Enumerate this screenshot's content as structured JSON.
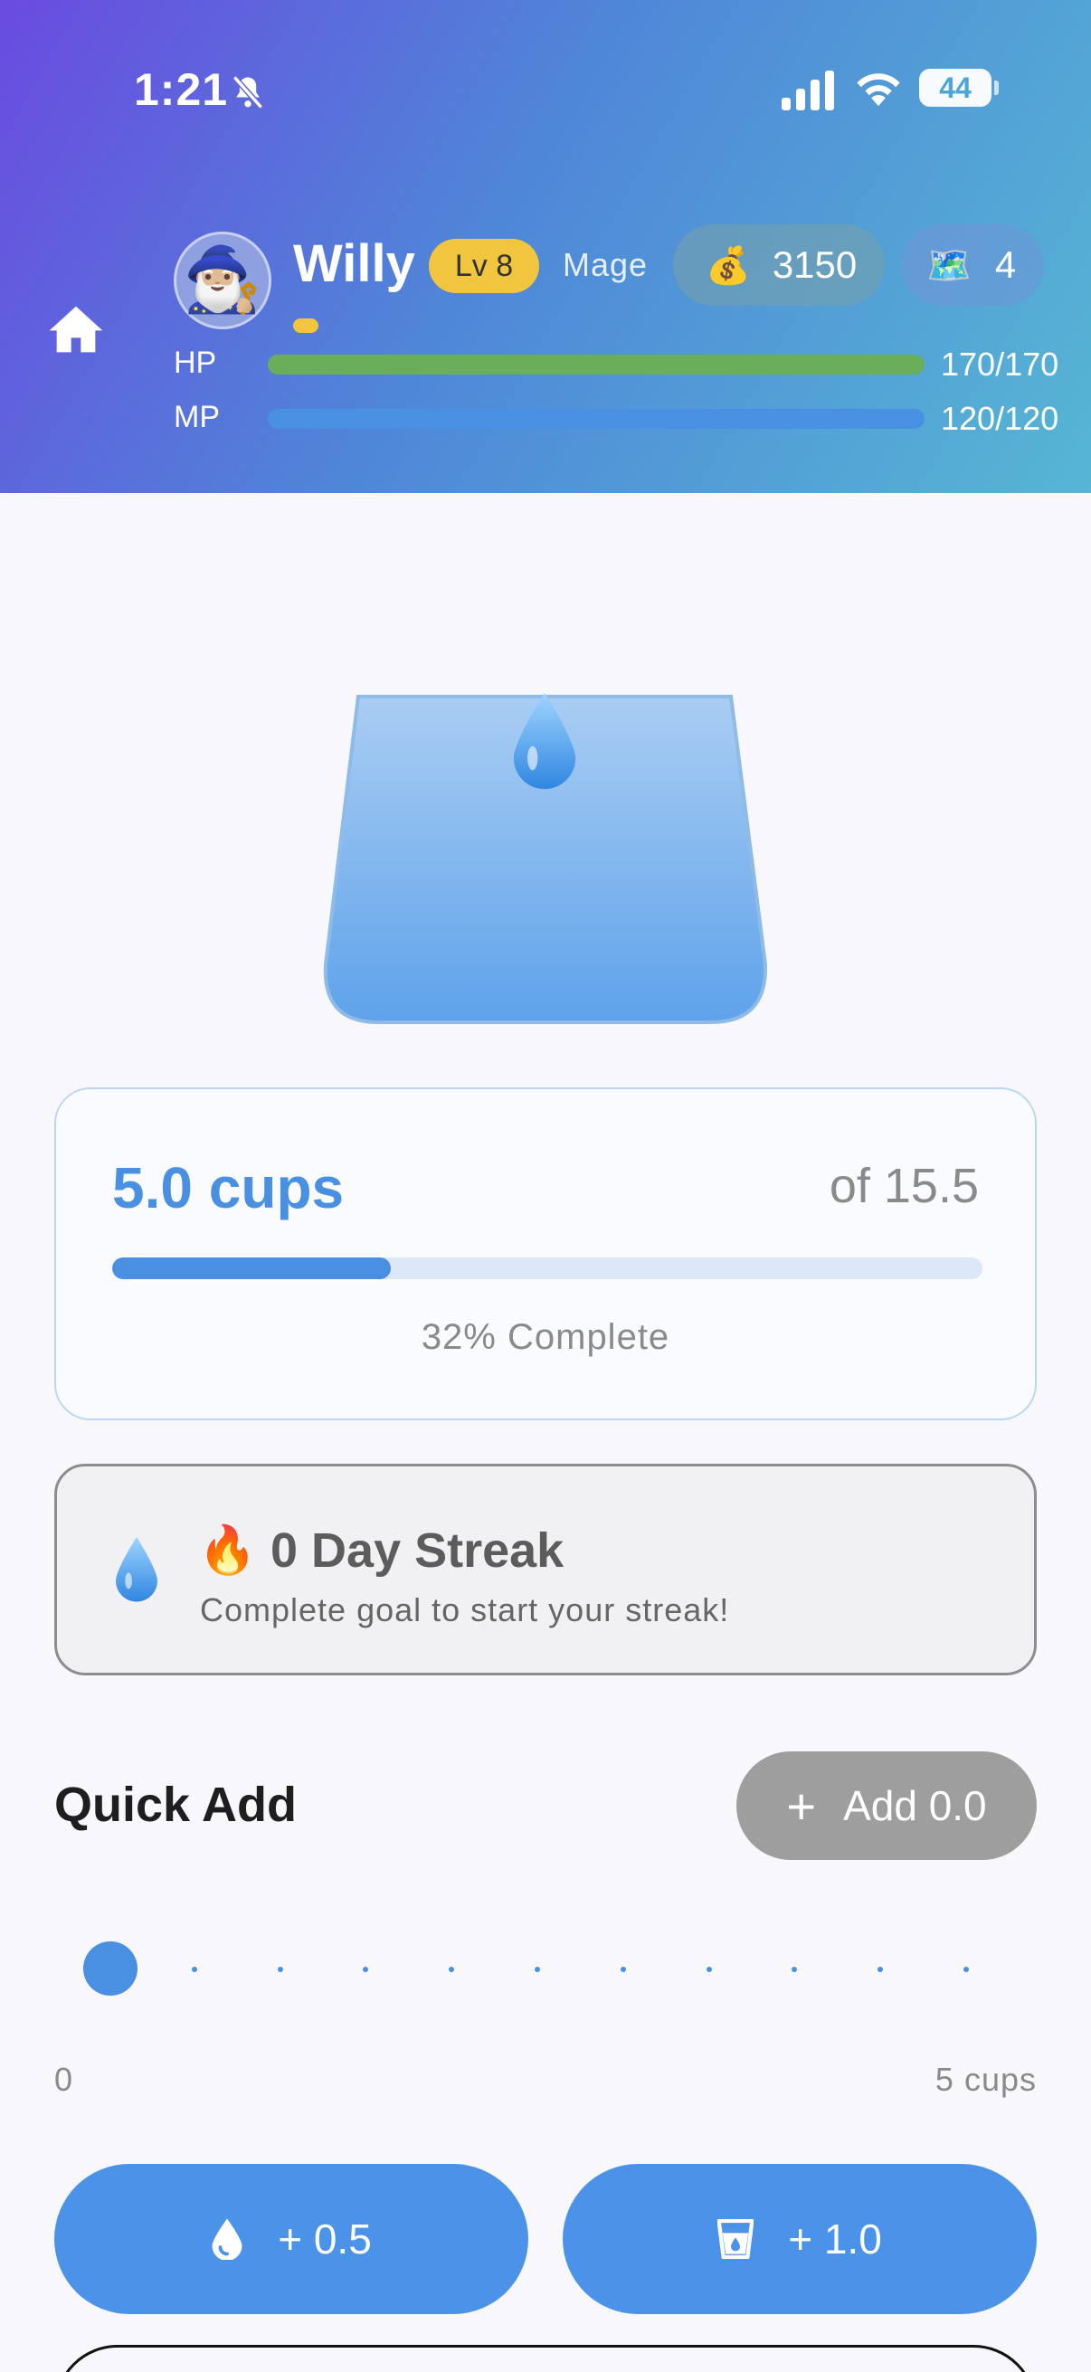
{
  "status_bar": {
    "time": "1:21",
    "battery": "44"
  },
  "player": {
    "name": "Willy",
    "level": "Lv 8",
    "class": "Mage",
    "gold": "3150",
    "maps": "4",
    "hp_label": "HP",
    "hp_value": "170/170",
    "hp_fraction": 1.0,
    "mp_label": "MP",
    "mp_value": "120/120",
    "mp_fraction": 1.0
  },
  "progress": {
    "amount": "5.0 cups",
    "goal": "of 15.5",
    "fraction": 0.32,
    "percent_text": "32% Complete"
  },
  "streak": {
    "title": "0 Day Streak",
    "subtitle": "Complete goal to start your streak!"
  },
  "quick_add": {
    "title": "Quick Add",
    "add_button": "Add 0.0",
    "slider_min": "0",
    "slider_max": "5 cups",
    "slider_value": 0,
    "slider_steps": 10
  },
  "buttons": {
    "half": "+ 0.5",
    "one": "+ 1.0"
  },
  "colors": {
    "accent": "#4a90e2",
    "hp": "#6aae5c",
    "mp": "#4a90e2",
    "level_badge": "#f2c53e"
  },
  "icons": {
    "home": "home-icon",
    "bell": "bell-slash-icon",
    "gold": "money-bag-icon",
    "map": "map-icon",
    "drop": "water-drop-icon",
    "fire": "fire-icon",
    "cup": "cup-icon"
  }
}
